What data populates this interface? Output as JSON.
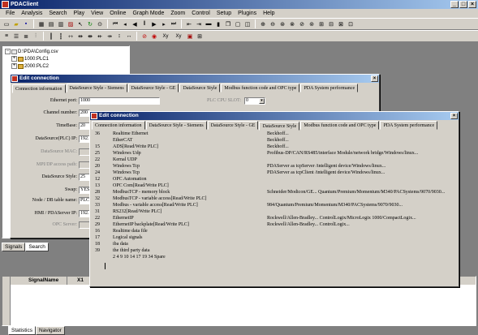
{
  "app": {
    "title": "PDAClient"
  },
  "menu": [
    "File",
    "Analysis",
    "Search",
    "Play",
    "View",
    "Online",
    "Graph Mode",
    "Zoom",
    "Control",
    "Setup",
    "Plugins",
    "Help"
  ],
  "tree": {
    "root": "D:\\PDA\\Config.csv",
    "children": [
      "1000:PLC1",
      "2000:PLC2"
    ]
  },
  "panel_tabs": [
    "Signals",
    "Search"
  ],
  "signal_table": {
    "headers": [
      "SignalName",
      "X1"
    ]
  },
  "bottom_tabs": [
    "Statistics",
    "Navigator"
  ],
  "dialog1": {
    "title": "Edit connection",
    "tabs": [
      "Connection information",
      "DataSource Style - Siemens",
      "DataSource Style - GE",
      "DataSource Style",
      "Modbus function code and OPC type",
      "PDA System performance"
    ],
    "fields": [
      {
        "label": "Ethernet port:",
        "value": "1000"
      },
      {
        "label": "Channel number:",
        "value": "200"
      },
      {
        "label": "TimeBase:",
        "value": "20"
      },
      {
        "label": "DataSource(PLC) IP:",
        "value": "192."
      },
      {
        "label": "DataSource MAC:",
        "value": ""
      },
      {
        "label": "MPI/DP access path:",
        "value": ""
      },
      {
        "label": "DataSource Style:",
        "value": "25"
      },
      {
        "label": "Swap:",
        "value": "YES"
      },
      {
        "label": "Node / DB table name:",
        "value": "PLC"
      },
      {
        "label": "HMI / PDAServer IP:",
        "value": "192."
      },
      {
        "label": "OPC Server:",
        "value": ""
      }
    ],
    "plc_cpu_slot_label": "PLC CPU SLOT:",
    "plc_cpu_slot_value": "0"
  },
  "dialog2": {
    "title": "Edit connection",
    "tabs": [
      "Connection information",
      "DataSource Style - Siemens",
      "DataSource Style - GE",
      "DataSource Style",
      "Modbus function code and OPC type",
      "PDA System performance"
    ],
    "rows": [
      {
        "code": "36",
        "name": "Realtime Ethernet",
        "desc": "Beckhoff..."
      },
      {
        "code": "",
        "name": "EtherCAT",
        "desc": "Beckhoff..."
      },
      {
        "code": "15",
        "name": "ADS[Read/Write PLC]",
        "desc": "Beckhoff..."
      },
      {
        "code": "25",
        "name": "Windows Udp",
        "desc": "Profibus-DP/CAN/RS485/interface Module/network bridge/Windows/linux..."
      },
      {
        "code": "22",
        "name": "Kernal UDP",
        "desc": ""
      },
      {
        "code": "20",
        "name": "Windows Tcp",
        "desc": "PDAServer as tcpServer /intelligent device/Windows/linux..."
      },
      {
        "code": "24",
        "name": "Windows Tcp",
        "desc": "PDAServer as tcpClient /intelligent device/Windows/linux..."
      },
      {
        "code": "12",
        "name": "OPC Automation",
        "desc": ""
      },
      {
        "code": "13",
        "name": "OPC Com[Read/Write PLC]",
        "desc": ""
      },
      {
        "code": "28",
        "name": "ModbusTCP - memory block",
        "desc": "Schneider/Modicon/GE... Quantum/Premium/Momentum/M340/PACSystems/9070/9030..."
      },
      {
        "code": "32",
        "name": "ModbusTCP - variable access[Read/Write PLC]",
        "desc": ""
      },
      {
        "code": "33",
        "name": "Modbus - variable access[Read/Write PLC]",
        "desc": "984/Quantum/Premium/Momentum/M340/PACSystems/9070/9030..."
      },
      {
        "code": "31",
        "name": "RS232[Read/Write PLC]",
        "desc": ""
      },
      {
        "code": "22",
        "name": "EthernetIP",
        "desc": "Rockwell/Allen-Bradley... ControlLogix/MicroLogix 1000/CompactLogix..."
      },
      {
        "code": "29",
        "name": "EthernetIP backplate[Read/Write PLC]",
        "desc": "Rockwell/Allen-Bradley... ControlLogix..."
      },
      {
        "code": "16",
        "name": "Realtime data file",
        "desc": ""
      },
      {
        "code": "17",
        "name": "Logical signals",
        "desc": ""
      },
      {
        "code": "18",
        "name": "iba data",
        "desc": ""
      },
      {
        "code": "39",
        "name": "the third party data",
        "desc": ""
      },
      {
        "code": "",
        "name": "2 4 9 10 14 17 19 34 Spare",
        "desc": ""
      }
    ]
  }
}
